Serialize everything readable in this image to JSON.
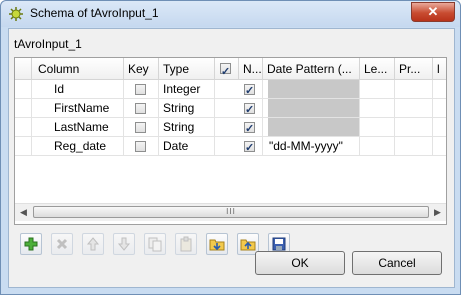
{
  "window": {
    "title": "Schema of tAvroInput_1",
    "close_label": "✕"
  },
  "schema_label": "tAvroInput_1",
  "table": {
    "columns": [
      "Column",
      "Key",
      "Type",
      "N...",
      "Date Pattern (...",
      "Le...",
      "Pr...",
      "l"
    ],
    "header_checkbox_checked": true,
    "rows": [
      {
        "column": "Id",
        "key": false,
        "type": "Integer",
        "nullable": true,
        "date_pattern": ""
      },
      {
        "column": "FirstName",
        "key": false,
        "type": "String",
        "nullable": true,
        "date_pattern": ""
      },
      {
        "column": "LastName",
        "key": false,
        "type": "String",
        "nullable": true,
        "date_pattern": ""
      },
      {
        "column": "Reg_date",
        "key": false,
        "type": "Date",
        "nullable": true,
        "date_pattern": "\"dd-MM-yyyy\""
      }
    ],
    "scroll_left": "◀",
    "scroll_right": "▶",
    "scroll_grip": "III"
  },
  "toolbar": [
    "add-icon",
    "remove-icon",
    "move-up-icon",
    "move-down-icon",
    "copy-icon",
    "paste-icon",
    "import-icon",
    "export-icon",
    "save-icon"
  ],
  "buttons": {
    "ok": "OK",
    "cancel": "Cancel"
  }
}
